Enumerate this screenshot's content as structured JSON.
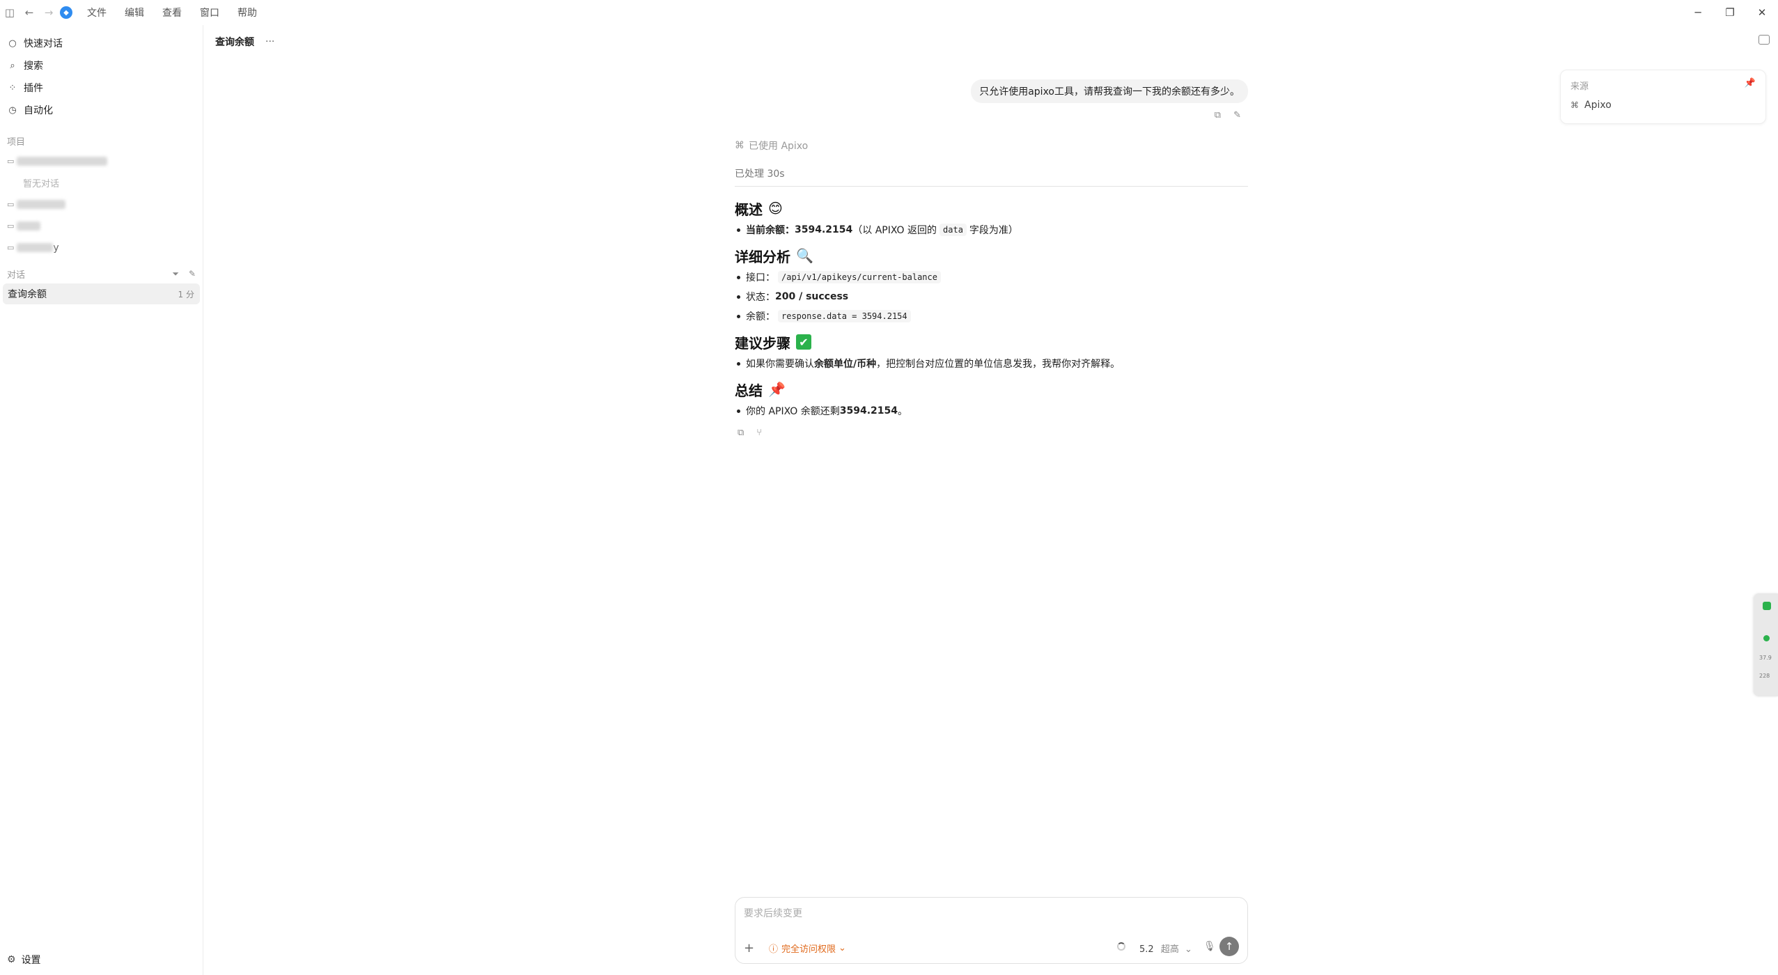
{
  "titlebar": {
    "menus": [
      "文件",
      "编辑",
      "查看",
      "窗口",
      "帮助"
    ]
  },
  "sidebar": {
    "nav": [
      {
        "label": "快速对话",
        "icon": "chat-circle-icon"
      },
      {
        "label": "搜索",
        "icon": "search-icon"
      },
      {
        "label": "插件",
        "icon": "plugin-grid-icon"
      },
      {
        "label": "自动化",
        "icon": "clock-icon"
      }
    ],
    "projects_label": "项目",
    "empty_note": "暂无对话",
    "project_partial_label": "y",
    "conversations_label": "对话",
    "conversation": {
      "title": "查询余额",
      "time": "1 分"
    },
    "settings_label": "设置"
  },
  "header": {
    "title": "查询余额",
    "more": "···"
  },
  "chat": {
    "user_message": "只允许使用apixo工具，请帮我查询一下我的余额还有多少。",
    "tool_used": "已使用 Apixo",
    "processed": "已处理 30s",
    "sections": {
      "overview_title": "概述",
      "overview_emoji": "😊",
      "balance_label": "当前余额：",
      "balance_value": "3594.2154",
      "balance_note_a": "（以 APIXO 返回的",
      "balance_note_code": "data",
      "balance_note_b": "字段为准）",
      "detail_title": "详细分析",
      "detail_emoji": "🔍",
      "endpoint_label": "接口：",
      "endpoint_code": "/api/v1/apikeys/current-balance",
      "status_label": "状态：",
      "status_value": "200 / success",
      "balance2_label": "余额：",
      "balance2_code": "response.data = 3594.2154",
      "steps_title": "建议步骤",
      "steps_emoji": "✔",
      "steps_text_a": "如果你需要确认",
      "steps_text_bold": "余额单位/币种",
      "steps_text_b": "，把控制台对应位置的单位信息发我，我帮你对齐解释。",
      "summary_title": "总结",
      "summary_emoji": "📌",
      "summary_text_a": "你的 APIXO 余额还剩 ",
      "summary_value": "3594.2154",
      "summary_text_b": "。"
    }
  },
  "sources": {
    "label": "来源",
    "item": "Apixo"
  },
  "composer": {
    "placeholder": "要求后续变更",
    "permission": "完全访问权限",
    "model": "5.2",
    "effort": "超高"
  },
  "widget": {
    "v1": "37.9",
    "v2": "228"
  }
}
